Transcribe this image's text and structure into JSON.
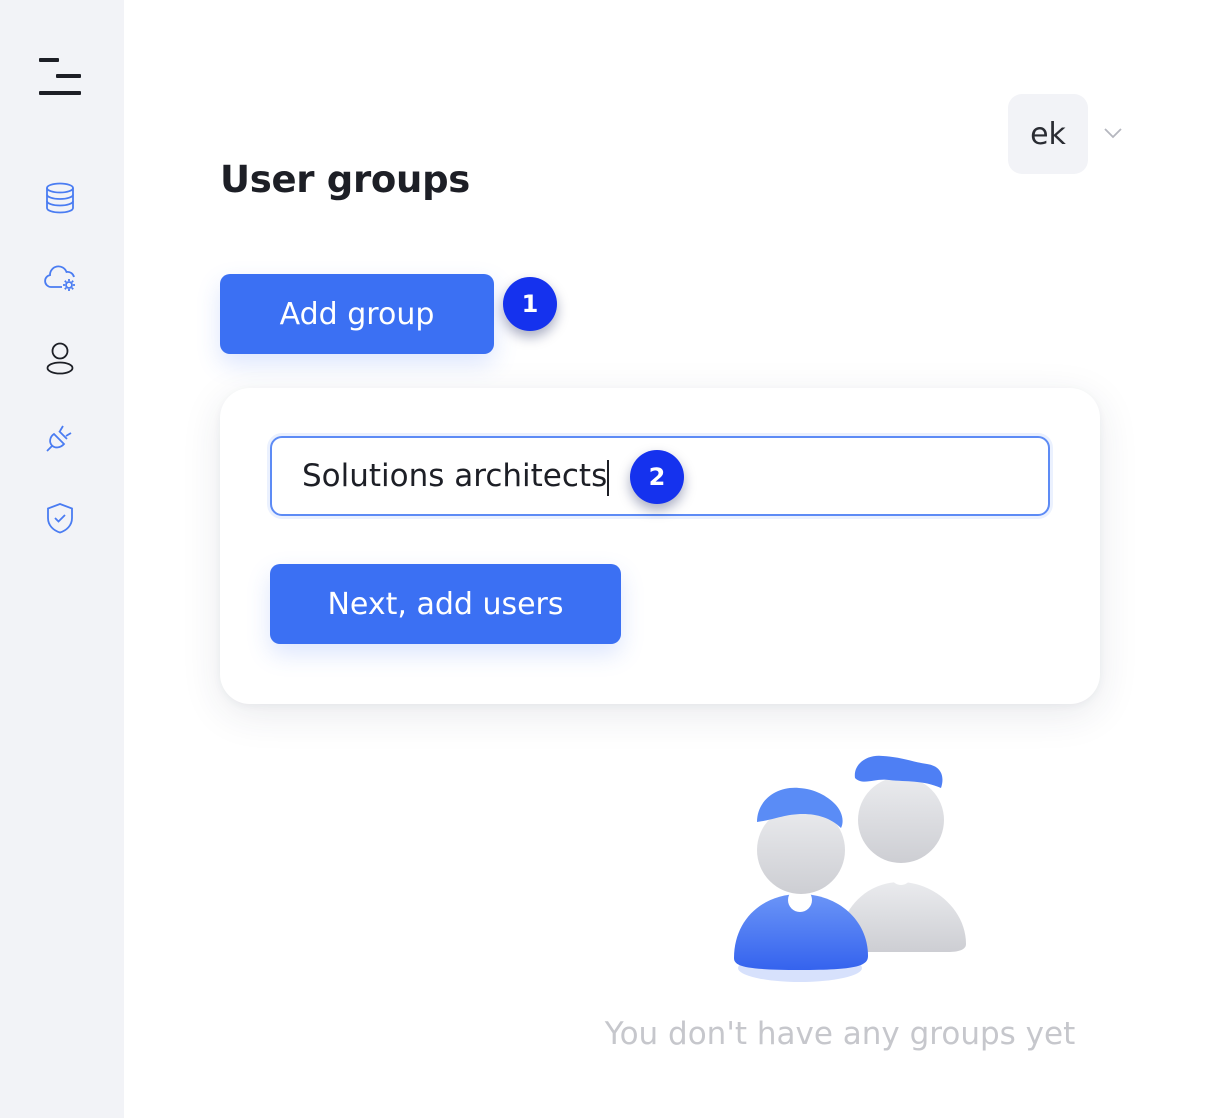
{
  "page": {
    "title": "User groups"
  },
  "sidebar": {
    "menu_icon": "hamburger-menu-icon",
    "items": [
      {
        "icon": "database-icon",
        "active": false
      },
      {
        "icon": "cloud-settings-icon",
        "active": false
      },
      {
        "icon": "user-icon",
        "active": true
      },
      {
        "icon": "plug-icon",
        "active": false
      },
      {
        "icon": "shield-check-icon",
        "active": false
      }
    ]
  },
  "user": {
    "initials": "ek",
    "menu_icon": "chevron-down-icon"
  },
  "actions": {
    "add_group_label": "Add group"
  },
  "steps": {
    "step1": "1",
    "step2": "2"
  },
  "group_form": {
    "name_value": "Solutions architects",
    "next_label": "Next, add users"
  },
  "empty_state": {
    "message": "You don't have any groups yet"
  },
  "colors": {
    "accent": "#3b70f3",
    "badge": "#1532ee",
    "sidebar_bg": "#f2f3f7",
    "icon_blue": "#4a7cf2",
    "muted_text": "#c6c7cc"
  }
}
